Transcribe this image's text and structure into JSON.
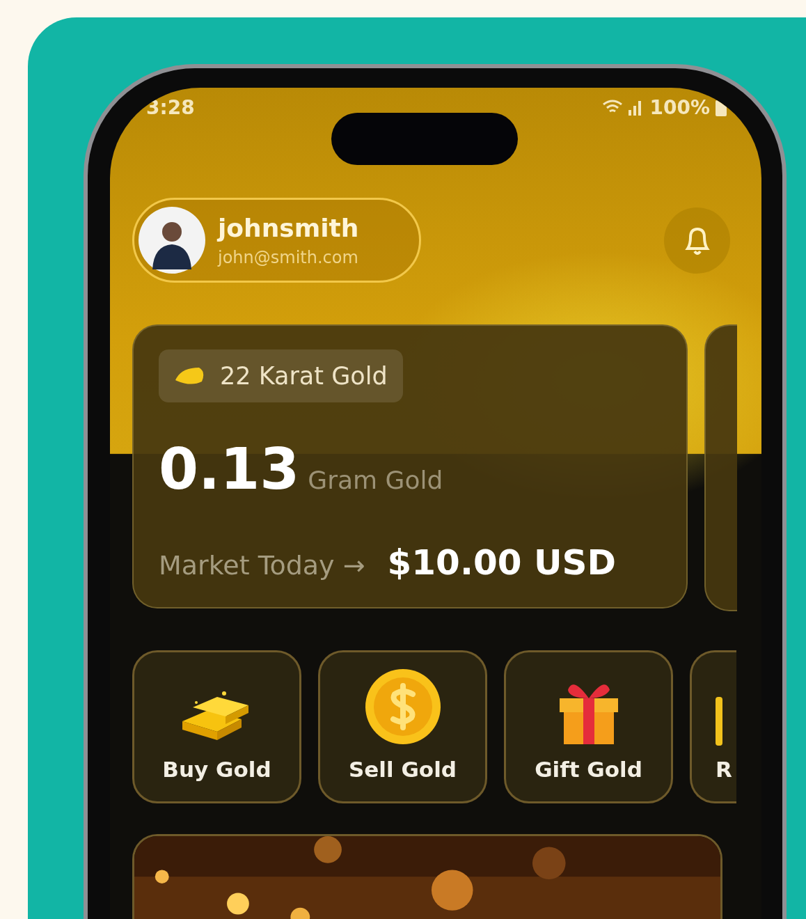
{
  "status_bar": {
    "time": "3:28",
    "battery": "100%"
  },
  "profile": {
    "name": "johnsmith",
    "email": "john@smith.com"
  },
  "balance_card": {
    "badge": "22 Karat Gold",
    "amount": "0.13",
    "unit": "Gram Gold",
    "market_label": "Market Today →",
    "price": "$10.00 USD"
  },
  "actions": [
    {
      "label": "Buy Gold",
      "kind": "bars"
    },
    {
      "label": "Sell Gold",
      "kind": "coin"
    },
    {
      "label": "Gift Gold",
      "kind": "gift"
    },
    {
      "label": "R",
      "kind": "partial"
    }
  ]
}
